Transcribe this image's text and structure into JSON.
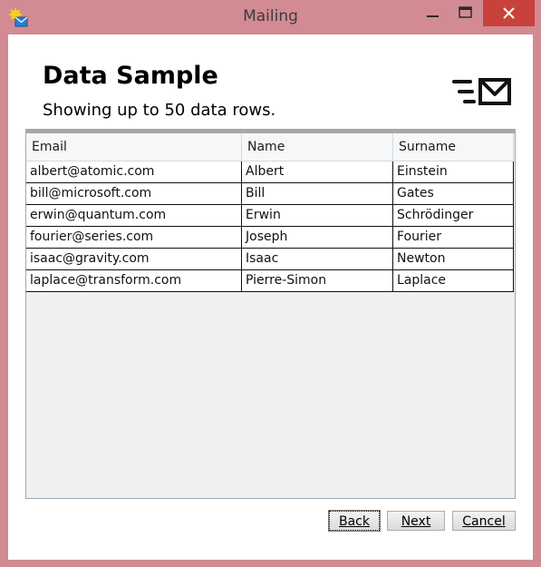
{
  "window": {
    "title": "Mailing",
    "accent": "#d28b93",
    "close_color": "#c9413b"
  },
  "page": {
    "heading": "Data Sample",
    "subtitle": "Showing up to 50 data rows.",
    "icon": "mail-send-icon"
  },
  "table": {
    "columns": [
      "Email",
      "Name",
      "Surname"
    ],
    "rows": [
      [
        "albert@atomic.com",
        "Albert",
        "Einstein"
      ],
      [
        "bill@microsoft.com",
        "Bill",
        "Gates"
      ],
      [
        "erwin@quantum.com",
        "Erwin",
        "Schrödinger"
      ],
      [
        "fourier@series.com",
        "Joseph",
        "Fourier"
      ],
      [
        "isaac@gravity.com",
        "Isaac",
        "Newton"
      ],
      [
        "laplace@transform.com",
        "Pierre-Simon",
        "Laplace"
      ]
    ]
  },
  "buttons": {
    "back": "Back",
    "next": "Next",
    "cancel": "Cancel"
  }
}
